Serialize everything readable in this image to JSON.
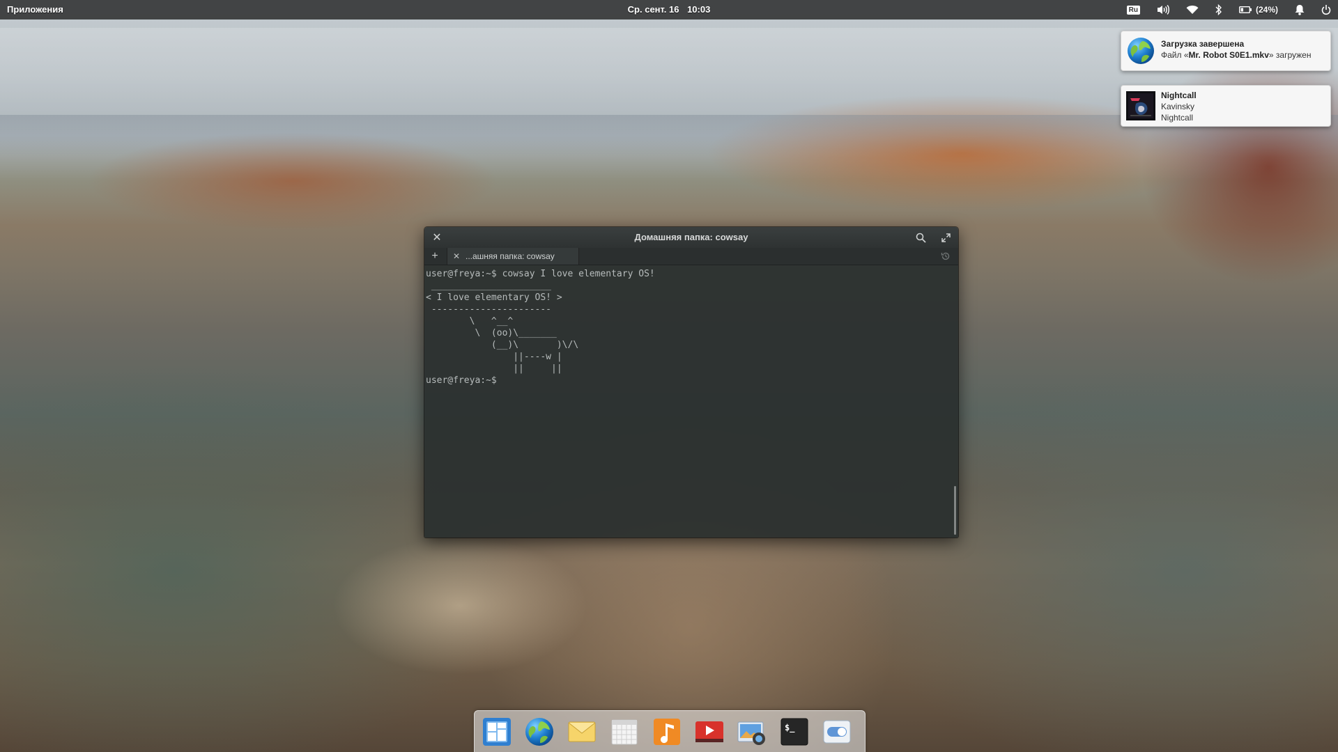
{
  "panel": {
    "apps_label": "Приложения",
    "date": "Ср. сент. 16",
    "time": "10:03",
    "keyboard_layout": "Ru",
    "battery_percent": "(24%)",
    "icons": [
      "keyboard-layout-icon",
      "volume-icon",
      "wifi-icon",
      "bluetooth-icon",
      "battery-icon",
      "notifications-bell-icon",
      "power-icon"
    ]
  },
  "notifications": [
    {
      "icon": "web-browser-icon",
      "title": "Загрузка завершена",
      "body_prefix": "Файл «",
      "body_file": "Mr. Robot S0E1.mkv",
      "body_suffix": "» загружен"
    },
    {
      "icon": "album-art-icon",
      "title": "Nightcall",
      "artist": "Kavinsky",
      "album": "Nightcall"
    }
  ],
  "terminal": {
    "window_title": "Домашняя папка: cowsay",
    "tab_label": "...ашняя папка: cowsay",
    "lines": [
      "user@freya:~$ cowsay I love elementary OS!",
      " ______________________",
      "< I love elementary OS! >",
      " ----------------------",
      "        \\   ^__^",
      "         \\  (oo)\\_______",
      "            (__)\\       )\\/\\",
      "                ||----w |",
      "                ||     ||",
      "user@freya:~$ "
    ]
  },
  "dock": {
    "items": [
      {
        "name": "multitasking-view-icon",
        "color": "#3d8fd8"
      },
      {
        "name": "web-browser-icon",
        "color": "#2f8bd6"
      },
      {
        "name": "mail-icon",
        "color": "#f2c94c"
      },
      {
        "name": "calendar-icon",
        "color": "#e9e9e9"
      },
      {
        "name": "music-icon",
        "color": "#f08a24"
      },
      {
        "name": "videos-icon",
        "color": "#d8322b"
      },
      {
        "name": "photos-icon",
        "color": "#4a89c9"
      },
      {
        "name": "terminal-icon",
        "color": "#2b2b2b"
      },
      {
        "name": "system-settings-icon",
        "color": "#6fa0d8"
      }
    ]
  }
}
